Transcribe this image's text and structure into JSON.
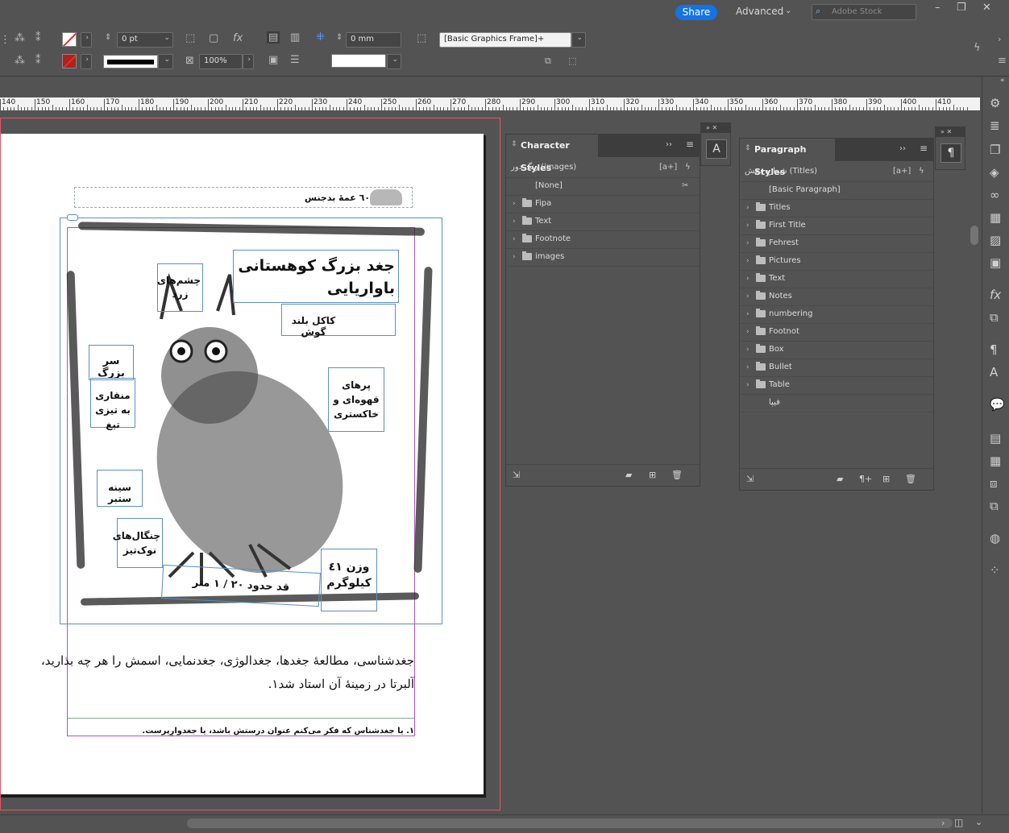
{
  "topbar": {
    "share_label": "Share",
    "workspace_label": "Advanced",
    "stock_placeholder": "Adobe Stock",
    "window_controls": [
      "minimize-icon",
      "restore-icon",
      "close-icon"
    ]
  },
  "control": {
    "stroke_weight": "0 pt",
    "scale": "100%",
    "offset": "0 mm",
    "object_style": "[Basic Graphics Frame]+"
  },
  "ruler": {
    "labels": [
      "140",
      "150",
      "160",
      "170",
      "180",
      "190",
      "200",
      "210",
      "220",
      "230",
      "240",
      "250",
      "260",
      "270",
      "280",
      "290",
      "300",
      "310",
      "320",
      "330",
      "340",
      "350",
      "360",
      "370",
      "380",
      "390",
      "400",
      "410"
    ]
  },
  "document": {
    "header_text": "٦٠  عمهٔ بدجنس",
    "illustration": {
      "title": "جغد بزرگ کوهستانی باواریایی",
      "labels": {
        "eyes": "چشم‌های زرد",
        "crest": "کاکل بلند گوش",
        "head": "سر بزرگ",
        "beak": "منقاری به تیزی تیغ",
        "feathers": "پرهای قهوه‌ای و خاکستری",
        "chest": "سینه ستبر",
        "claws": "چنگال‌های نوک‌تیز",
        "height": "قد حدود ۲۰ / ۱ متر",
        "weight": "وزن ٤١ کیلوگرم"
      }
    },
    "body_line1": "جغدشناسی، مطالعهٔ جغدها، جغدالوژی، جغدنمایی، اسمش را هر چه بذارید،",
    "body_line2": "آلبرتا در زمینهٔ آن استاد شد١.",
    "footnote": "١. یا جغدشناس که فکر می‌کنم عنوان درستش باشد، یا جغدوارِپرست."
  },
  "character_styles": {
    "tab": "Character Styles",
    "current": "رنگ دور (images)",
    "items": [
      {
        "label": "[None]",
        "folder": false
      },
      {
        "label": "Fipa",
        "folder": true
      },
      {
        "label": "Text",
        "folder": true
      },
      {
        "label": "Footnote",
        "folder": true
      },
      {
        "label": "images",
        "folder": true
      }
    ]
  },
  "paragraph_styles": {
    "tab": "Paragraph Styles",
    "current": "شماره بخش (Titles)",
    "items": [
      {
        "label": "[Basic Paragraph]",
        "folder": false
      },
      {
        "label": "Titles",
        "folder": true
      },
      {
        "label": "First Title",
        "folder": true
      },
      {
        "label": "Fehrest",
        "folder": true
      },
      {
        "label": "Pictures",
        "folder": true
      },
      {
        "label": "Text",
        "folder": true
      },
      {
        "label": "Notes",
        "folder": true
      },
      {
        "label": "numbering",
        "folder": true
      },
      {
        "label": "Footnot",
        "folder": true
      },
      {
        "label": "Box",
        "folder": true
      },
      {
        "label": "Bullet",
        "folder": true
      },
      {
        "label": "Table",
        "folder": true
      },
      {
        "label": "فیپا",
        "folder": false
      }
    ]
  },
  "colors": {
    "accent": "#1473e6",
    "panel_bg": "#535353",
    "frame_blue": "#5c8fc4",
    "frame_purple": "#b450c8",
    "bleed": "#e0576a"
  }
}
